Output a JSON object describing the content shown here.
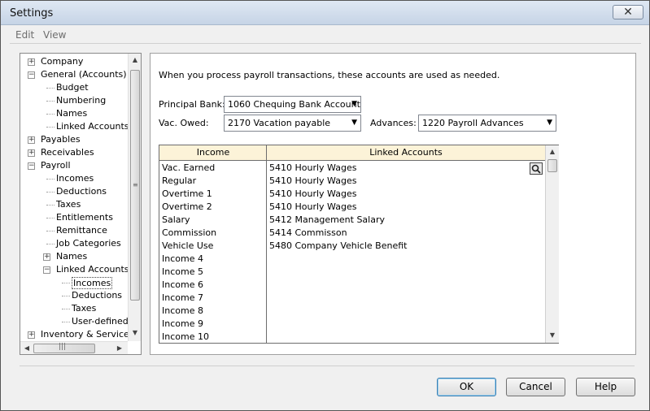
{
  "window": {
    "title": "Settings",
    "close_label": "✕"
  },
  "menu": [
    "Edit",
    "View"
  ],
  "tree": [
    {
      "label": "Company",
      "level": 0,
      "toggle": "+"
    },
    {
      "label": "General (Accounts)",
      "level": 0,
      "toggle": "−"
    },
    {
      "label": "Budget",
      "level": 1
    },
    {
      "label": "Numbering",
      "level": 1
    },
    {
      "label": "Names",
      "level": 1
    },
    {
      "label": "Linked Accounts",
      "level": 1
    },
    {
      "label": "Payables",
      "level": 0,
      "toggle": "+"
    },
    {
      "label": "Receivables",
      "level": 0,
      "toggle": "+"
    },
    {
      "label": "Payroll",
      "level": 0,
      "toggle": "−"
    },
    {
      "label": "Incomes",
      "level": 1
    },
    {
      "label": "Deductions",
      "level": 1
    },
    {
      "label": "Taxes",
      "level": 1
    },
    {
      "label": "Entitlements",
      "level": 1
    },
    {
      "label": "Remittance",
      "level": 1
    },
    {
      "label": "Job Categories",
      "level": 1
    },
    {
      "label": "Names",
      "level": 1,
      "toggle": "+"
    },
    {
      "label": "Linked Accounts",
      "level": 1,
      "toggle": "−"
    },
    {
      "label": "Incomes",
      "level": 2,
      "selected": true
    },
    {
      "label": "Deductions",
      "level": 2
    },
    {
      "label": "Taxes",
      "level": 2
    },
    {
      "label": "User-defined E",
      "level": 2
    },
    {
      "label": "Inventory & Services",
      "level": 0,
      "toggle": "+"
    }
  ],
  "content": {
    "intro": "When you process payroll transactions, these accounts are used as needed.",
    "principal_bank_label": "Principal Bank:",
    "principal_bank_value": "1060 Chequing Bank Account",
    "vac_owed_label": "Vac. Owed:",
    "vac_owed_value": "2170 Vacation payable",
    "advances_label": "Advances:",
    "advances_value": "1220 Payroll Advances",
    "grid": {
      "col_income": "Income",
      "col_accounts": "Linked Accounts",
      "rows": [
        {
          "income": "Vac. Earned",
          "account": "5410 Hourly Wages"
        },
        {
          "income": "Regular",
          "account": "5410 Hourly Wages"
        },
        {
          "income": "Overtime 1",
          "account": "5410 Hourly Wages"
        },
        {
          "income": "Overtime 2",
          "account": "5410 Hourly Wages"
        },
        {
          "income": "Salary",
          "account": "5412 Management Salary"
        },
        {
          "income": "Commission",
          "account": "5414 Commisson"
        },
        {
          "income": "Vehicle  Use",
          "account": "5480 Company Vehicle Benefit"
        },
        {
          "income": "Income 4",
          "account": ""
        },
        {
          "income": "Income 5",
          "account": ""
        },
        {
          "income": "Income 6",
          "account": ""
        },
        {
          "income": "Income 7",
          "account": ""
        },
        {
          "income": "Income 8",
          "account": ""
        },
        {
          "income": "Income 9",
          "account": ""
        },
        {
          "income": "Income 10",
          "account": ""
        }
      ]
    }
  },
  "buttons": {
    "ok": "OK",
    "cancel": "Cancel",
    "help": "Help"
  },
  "icons": [
    "expand-icon",
    "collapse-icon",
    "dropdown-arrow-icon",
    "lookup-icon",
    "close-icon"
  ]
}
